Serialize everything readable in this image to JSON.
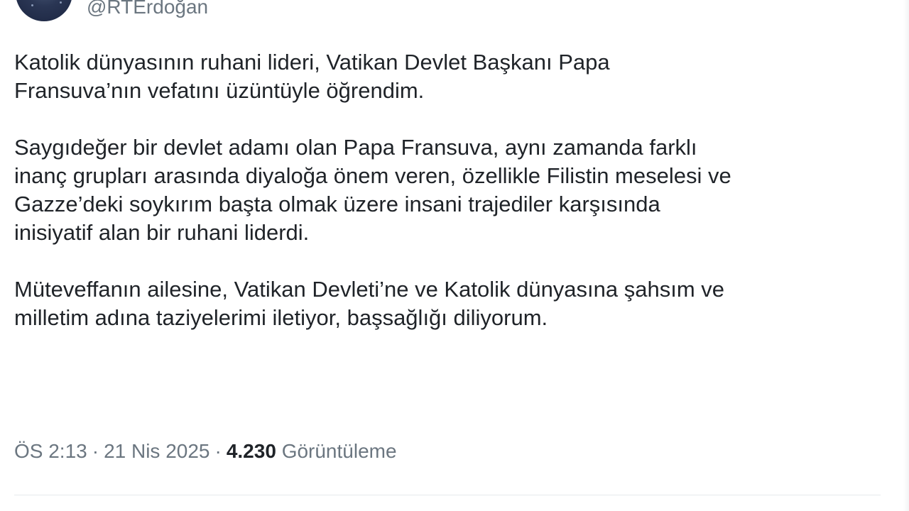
{
  "author": {
    "handle": "@RTErdoğan"
  },
  "tweet": {
    "paragraphs": [
      {
        "lines": [
          "Katolik dünyasının ruhani lideri, Vatikan Devlet Başkanı Papa",
          "Fransuva’nın vefatını üzüntüyle öğrendim."
        ]
      },
      {
        "lines": [
          "Saygıdeğer bir devlet adamı olan Papa Fransuva, aynı zamanda farklı",
          "inanç grupları arasında diyaloğa önem veren, özellikle Filistin meselesi ve",
          "Gazze’deki soykırım başta olmak üzere insani trajediler karşısında",
          "inisiyatif alan bir ruhani liderdi."
        ]
      },
      {
        "lines": [
          "Müteveffanın ailesine, Vatikan Devleti’ne ve Katolik dünyasına şahsım ve",
          "milletim adına taziyelerimi iletiyor, başsağlığı diliyorum."
        ]
      }
    ]
  },
  "meta": {
    "time": "ÖS 2:13",
    "separator": "·",
    "date": "21 Nis 2025",
    "views_count": "4.230",
    "views_label": "Görüntüleme"
  }
}
